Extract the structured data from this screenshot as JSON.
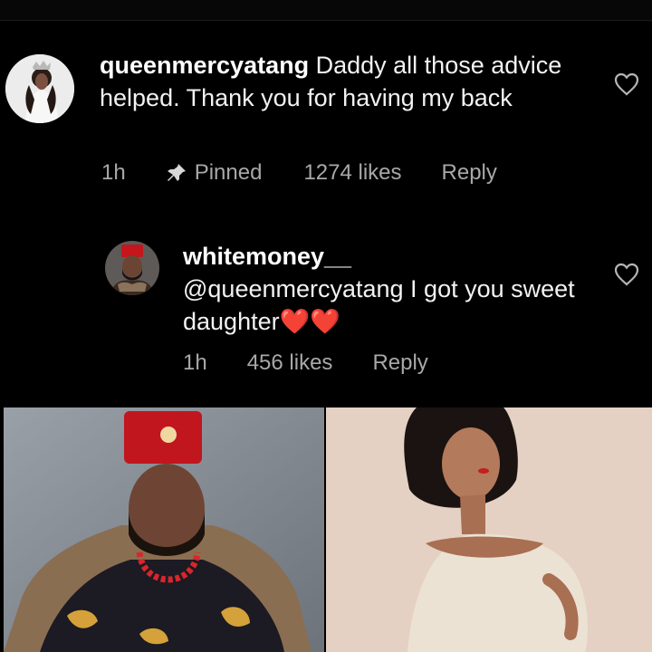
{
  "comment": {
    "username": "queenmercyatang",
    "text": "Daddy all those advice helped. Thank you for having my back",
    "time": "1h",
    "pinned_label": "Pinned",
    "likes": "1274 likes",
    "reply_label": "Reply",
    "icons": {
      "pin": "pin-icon",
      "like": "heart-outline-icon"
    }
  },
  "reply": {
    "username": "whitemoney__",
    "text": "@queenmercyatang I got you sweet daughter",
    "emoji": "❤️❤️",
    "time": "1h",
    "likes": "456 likes",
    "reply_label": "Reply",
    "icons": {
      "like": "heart-outline-icon"
    }
  },
  "colors": {
    "background": "#000000",
    "text": "#f2f2f2",
    "meta": "#a8a8a8",
    "heart": "#e5212b"
  }
}
